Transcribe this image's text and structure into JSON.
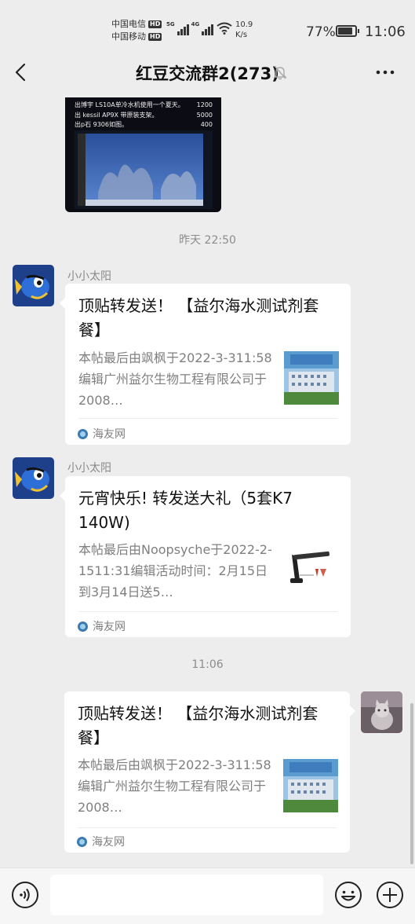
{
  "status_bar": {
    "carrier1": "中国电信",
    "carrier2": "中国移动",
    "hd": "HD",
    "signal1_label": "5G",
    "signal2_label": "4G",
    "speed_value": "10.9",
    "speed_unit": "K/s",
    "battery_percent": "77%",
    "time": "11:06"
  },
  "header": {
    "title": "红豆交流群2(273)"
  },
  "image_message": {
    "lines": [
      {
        "text": "出博宇 LS10A单冷水机使用一个夏天。",
        "price": "1200"
      },
      {
        "text": "出 kessil AP9X 带原装支架。",
        "price": "5000"
      },
      {
        "text": "出p石 9306如图。",
        "price": "400"
      }
    ]
  },
  "messages": {
    "time1": "昨天 22:50",
    "time2": "11:06",
    "msg1": {
      "sender": "小小太阳",
      "title": "顶贴转发送！ 【益尔海水测试剂套餐】",
      "desc": "本帖最后由飒枫于2022-3-311:58编辑广州益尔生物工程有限公司于2008…",
      "source": "海友网"
    },
    "msg2": {
      "sender": "小小太阳",
      "title": "元宵快乐! 转发送大礼（5套K7 140W)",
      "desc": "本帖最后由Noopsyche于2022-2-1511:31编辑活动时间：2月15日到3月14日送5…",
      "source": "海友网"
    },
    "msg3": {
      "title": "顶贴转发送！ 【益尔海水测试剂套餐】",
      "desc": "本帖最后由飒枫于2022-3-311:58编辑广州益尔生物工程有限公司于2008…",
      "source": "海友网"
    }
  },
  "icons": {
    "back": "chevron-left-icon",
    "mute": "bell-off-icon",
    "more": "more-dots-icon",
    "voice": "voice-icon",
    "emoji": "emoji-icon",
    "plus": "plus-icon"
  },
  "colors": {
    "background": "#ededed",
    "bubble": "#ffffff",
    "source_icon": "#3c7bb0"
  }
}
